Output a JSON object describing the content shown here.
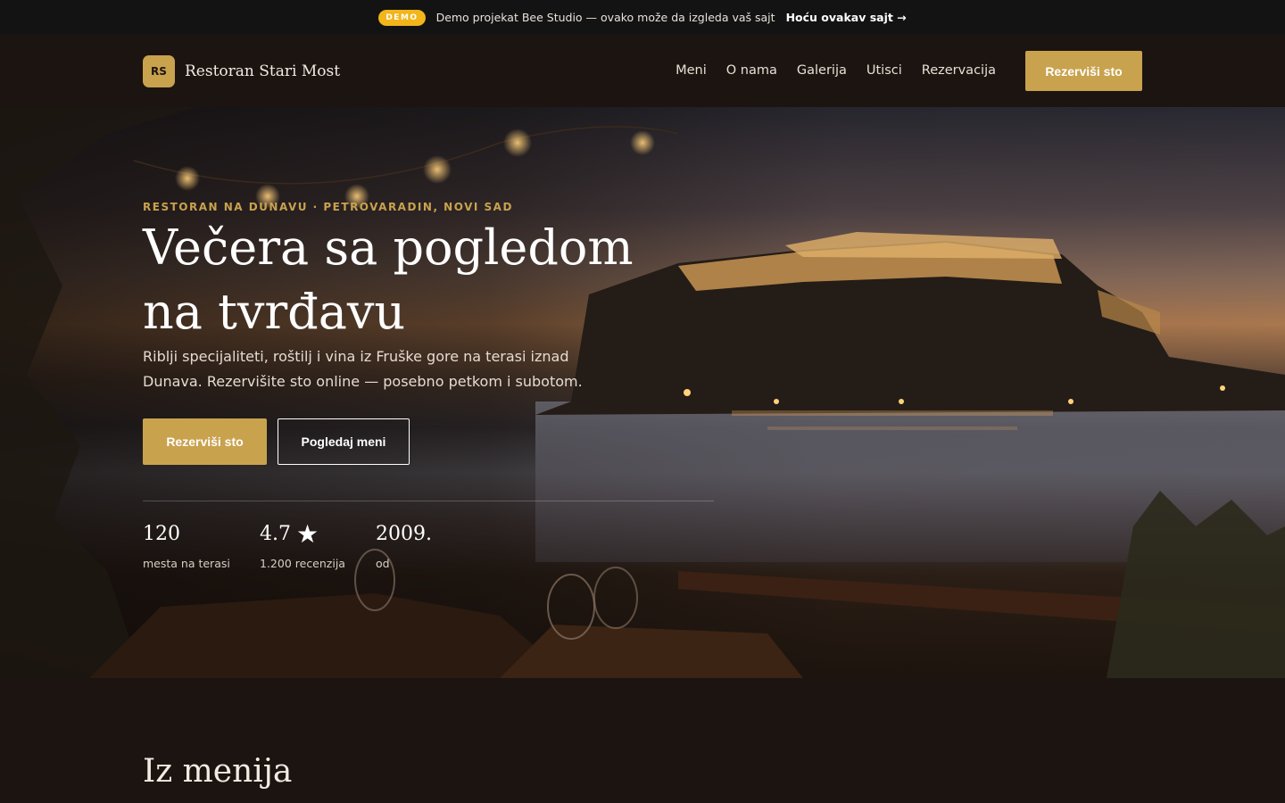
{
  "demo_bar": {
    "badge": "DEMO",
    "text": "Demo projekat Bee Studio — ovako može da izgleda vaš sajt",
    "cta": "Hoću ovakav sajt →"
  },
  "brand": {
    "mark": "RS",
    "name": "Restoran Stari Most"
  },
  "nav": {
    "items": [
      "Meni",
      "O nama",
      "Galerija",
      "Utisci",
      "Rezervacija"
    ],
    "cta": "Rezerviši sto"
  },
  "hero": {
    "eyebrow": "RESTORAN NA DUNAVU · PETROVARADIN, NOVI SAD",
    "title": "Večera sa pogledom na tvrđavu",
    "subtitle": "Riblji specijaliteti, roštilj i vina iz Fruške gore na terasi iznad Dunava. Rezervišite sto online — posebno petkom i subotom.",
    "primary_button": "Rezerviši sto",
    "secondary_button": "Pogledaj meni",
    "stats": [
      {
        "value": "120",
        "label": "mesta na terasi"
      },
      {
        "value": "4.7",
        "icon": "star-icon",
        "label": "1.200 recenzija"
      },
      {
        "value": "2009.",
        "label": "od"
      }
    ]
  },
  "menu_section": {
    "title": "Iz menija"
  },
  "colors": {
    "accent": "#c9a24e",
    "badge": "#f2b51a",
    "background": "#1c1411",
    "banner": "#131313"
  }
}
